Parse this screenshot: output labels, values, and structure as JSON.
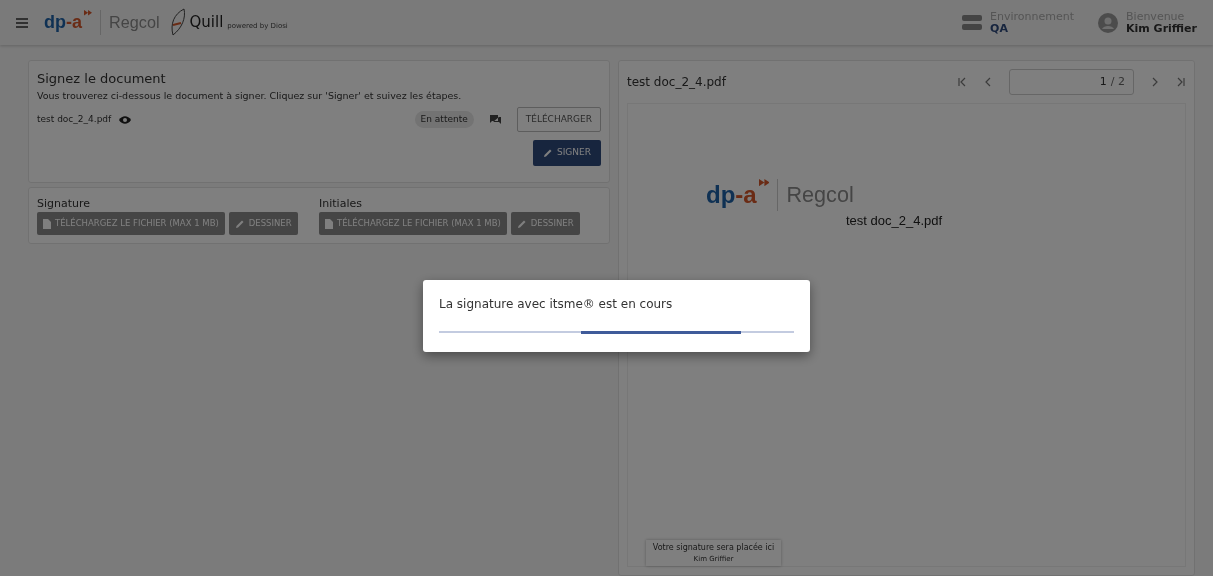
{
  "header": {
    "brand": {
      "part1": "dp",
      "dash": "-",
      "part2": "a",
      "product": "Regcol"
    },
    "app_name": "Quill",
    "powered_by": "powered by Diosi",
    "environment": {
      "label": "Environnement",
      "value": "QA"
    },
    "user": {
      "greeting": "Bienvenue",
      "name": "Kim Griffier"
    }
  },
  "sign_card": {
    "title": "Signez le document",
    "description": "Vous trouverez ci-dessous le document à signer. Cliquez sur 'Signer' et suivez les étapes.",
    "file_name": "test doc_2_4.pdf",
    "status": "En attente",
    "download_button": "TÉLÉCHARGER",
    "sign_button": "SIGNER"
  },
  "signature_sections": [
    {
      "label": "Signature",
      "upload_button": "TÉLÉCHARGEZ LE FICHIER (MAX 1 MB)",
      "draw_button": "DESSINER",
      "disabled": true
    },
    {
      "label": "Initiales",
      "upload_button": "TÉLÉCHARGEZ LE FICHIER (MAX 1 MB)",
      "draw_button": "DESSINER",
      "disabled": true
    }
  ],
  "viewer": {
    "title": "test doc_2_4.pdf",
    "page_value": "1",
    "page_total": "/ 2",
    "page": {
      "brand": {
        "part1": "dp",
        "dash": "-",
        "part2": "a",
        "product": "Regcol"
      },
      "doc_title": "test doc_2_4.pdf",
      "signature_placeholder": {
        "text": "Votre signature sera placée ici",
        "name": "Kim Griffier"
      }
    }
  },
  "modal": {
    "message": "La signature avec itsme® est en cours",
    "progress": {
      "indeterminate": true
    }
  }
}
